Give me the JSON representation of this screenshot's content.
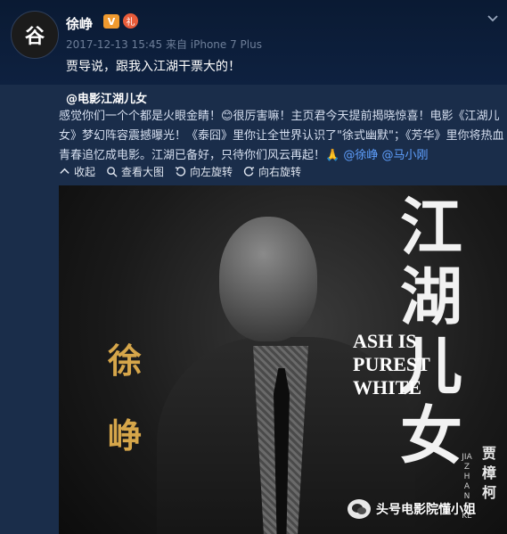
{
  "post": {
    "avatar_text": "谷",
    "username": "徐峥",
    "verified_badge": "V",
    "gift_badge": "礼",
    "timestamp": "2017-12-13 15:45",
    "source": "来自 iPhone 7 Plus",
    "text": "贾导说，跟我入江湖干票大的！"
  },
  "repost": {
    "author": "@电影江湖儿女",
    "body_part1": "感觉你们一个个都是火眼金睛！😊很厉害嘛！主页君今天提前揭晓惊喜！电影《江湖儿女》梦幻阵容震撼曝光！《泰囧》里你让全世界认识了\"徐式幽默\"；《芳华》里你将热血青春追忆成电影。江湖已备好，只待你们风云再起！🙏",
    "mention1": "@徐峥",
    "mention2": "@马小刚"
  },
  "toolbar": {
    "collapse": "收起",
    "view_large": "查看大图",
    "rotate_left": "向左旋转",
    "rotate_right": "向右旋转"
  },
  "poster": {
    "actor_name": "徐\n峥",
    "film_title": "江\n湖\n儿\n女",
    "english_lines": "ASH IS\nPUREST\nWHITE",
    "director": "贾\n樟\n柯",
    "director_en": "JIA ZHANGKE"
  },
  "watermark": {
    "text": "头号电影院懂小姐"
  },
  "colors": {
    "background": "#0f1d33",
    "link": "#5fa0ff",
    "badge_v": "#f09a2f",
    "poster_gold": "#d6a64a"
  }
}
